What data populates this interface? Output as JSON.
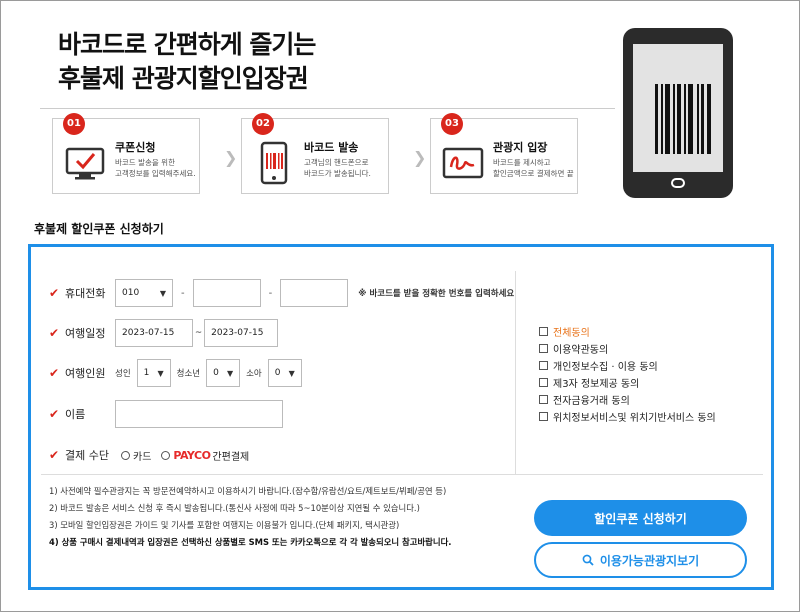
{
  "hero": {
    "line1": "바코드로 간편하게 즐기는",
    "line2": "후불제 관광지할인입장권"
  },
  "steps": [
    {
      "num": "01",
      "title": "쿠폰신청",
      "desc": "바코드 발송을 위한\n고객정보를 입력해주세요."
    },
    {
      "num": "02",
      "title": "바코드 발송",
      "desc": "고객님의 핸드폰으로\n바코드가 발송됩니다."
    },
    {
      "num": "03",
      "title": "관광지 입장",
      "desc": "바코드를 제시하고\n할인금액으로 결제하면 끝"
    }
  ],
  "chevron": "❯",
  "section_title": "후불제 할인쿠폰 신청하기",
  "form": {
    "check": "✔",
    "phone": {
      "label": "휴대전화",
      "prefix": "010",
      "mid": "",
      "last": "",
      "dash": "-",
      "note": "※ 바코드를 받을 정확한 번호를 입력하세요"
    },
    "dates": {
      "label": "여행일정",
      "start": "2023-07-15",
      "sep": "~",
      "end": "2023-07-15"
    },
    "people": {
      "label": "여행인원",
      "adult_label": "성인",
      "adult": "1",
      "teen_label": "청소년",
      "teen": "0",
      "child_label": "소아",
      "child": "0"
    },
    "name": {
      "label": "이름",
      "value": ""
    },
    "payment": {
      "label": "결제 수단",
      "card": "카드",
      "payco": "PAYCO",
      "payco_suffix": "간편결제"
    }
  },
  "agreements": {
    "all": "전체동의",
    "items": [
      "이용약관동의",
      "개인정보수집 · 이용 동의",
      "제3자 정보제공 동의",
      "전자금융거래 동의",
      "위치정보서비스및 위치기반서비스 동의"
    ]
  },
  "notes": [
    "1) 사전예약 필수관광지는 꼭 방문전예약하시고 이용하시기 바랍니다.(잠수함/유람선/요트/제트보트/뷔페/공연 등)",
    "2) 바코드 발송은 서비스 신청 후 즉시 발송됩니다.(통신사 사정에 따라 5~10분이상 지연될 수 있습니다.)",
    "3) 모바일 할인입장권은 가이드 및 기사를 포함한 여행지는 이용불가 입니다.(단체 패키지, 택시관광)",
    "4) 상품 구매시 결제내역과 입장권은 선택하신 상품별로 SMS 또는 카카오톡으로 각 각 발송되오니 참고바랍니다."
  ],
  "buttons": {
    "apply": "할인쿠폰 신청하기",
    "view": "이용가능관광지보기"
  },
  "colors": {
    "accent": "#1e8fe8",
    "step_badge": "#d9261c",
    "check": "#d9261c",
    "agree_all": "#e8731a",
    "payco": "#e62a2a"
  }
}
